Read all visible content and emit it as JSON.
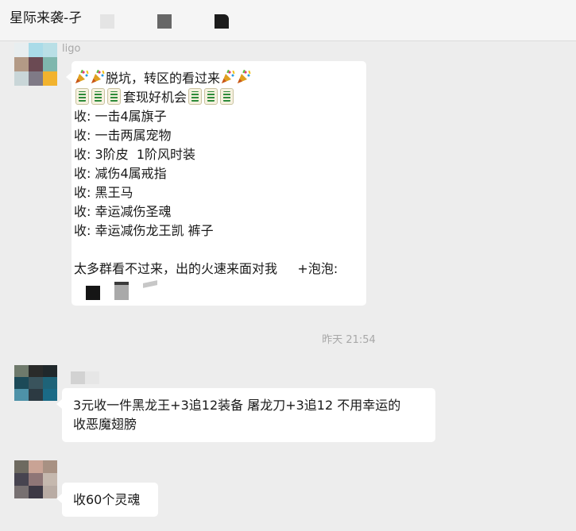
{
  "header": {
    "title": "星际来袭-孑"
  },
  "messages": [
    {
      "sender_name": "ligo",
      "lines": [
        "脱坑，转区的看过来",
        "套现好机会",
        "收: 一击4属旗子",
        "收: 一击两属宠物",
        "收: 3阶皮  1阶风时装",
        "收: 减伤4属戒指",
        "收: 黑王马",
        "收: 幸运减伤圣魂",
        "收: 幸运减伤龙王凯 裤子",
        "",
        "太多群看不过来，出的火速来面对我     +泡泡:"
      ]
    },
    {
      "text_line1": "3元收一件黑龙王+3追12装备 屠龙刀+3追12 不用幸运的",
      "text_line2": "收恶魔翅膀"
    },
    {
      "text": "收60个灵魂"
    }
  ],
  "timestamp": "昨天 21:54",
  "icons": {
    "party": "party-popper-icon",
    "tile": "mahjong-green-dragon-icon"
  },
  "colors": {
    "background": "#ededed",
    "bubble": "#ffffff",
    "meta_text": "#a8a8a8"
  }
}
